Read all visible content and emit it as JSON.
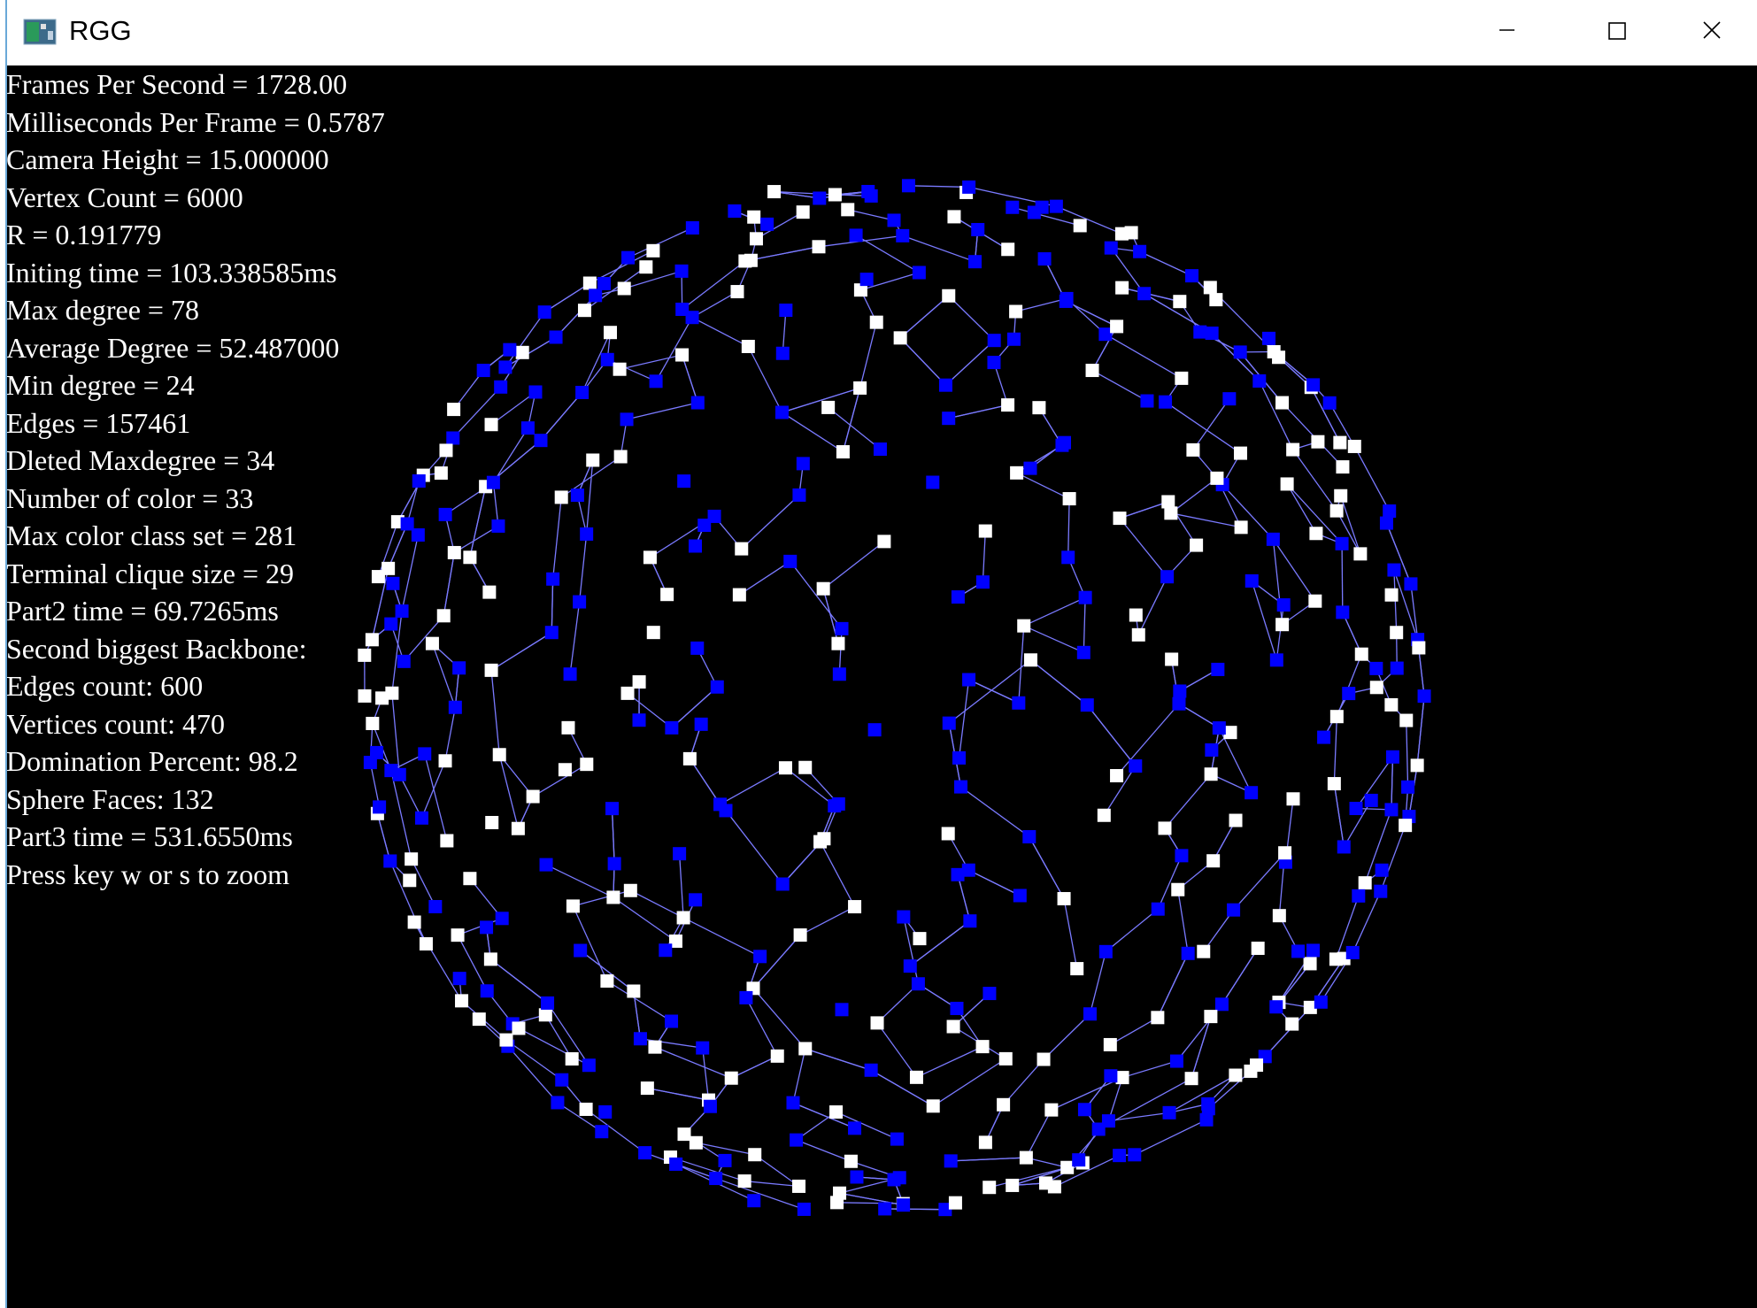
{
  "window": {
    "title": "RGG",
    "icon": "rgg-app-icon",
    "controls": {
      "minimize_icon": "minimize-icon",
      "maximize_icon": "maximize-icon",
      "close_icon": "close-icon"
    }
  },
  "hud": {
    "lines": [
      "Frames Per Second = 1728.00",
      "Milliseconds Per Frame = 0.5787",
      "Camera Height = 15.000000",
      "Vertex Count = 6000",
      "R = 0.191779",
      "Initing time = 103.338585ms",
      "Max degree = 78",
      "Average Degree = 52.487000",
      "Min degree = 24",
      "Edges = 157461",
      "Dleted Maxdegree = 34",
      "Number of color = 33",
      "Max color class set = 281",
      "Terminal clique size = 29",
      "Part2 time = 69.7265ms",
      "Second biggest Backbone:",
      "Edges count: 600",
      "Vertices count: 470",
      "Domination Percent: 98.2",
      "Sphere Faces: 132",
      "Part3 time = 531.6550ms",
      "Press key w or s to zoom"
    ]
  },
  "graph": {
    "description_colors": {
      "background": "#000000",
      "node_primary": "#ffffff",
      "node_secondary": "#0000ff",
      "edge": "#7a7aff"
    }
  }
}
